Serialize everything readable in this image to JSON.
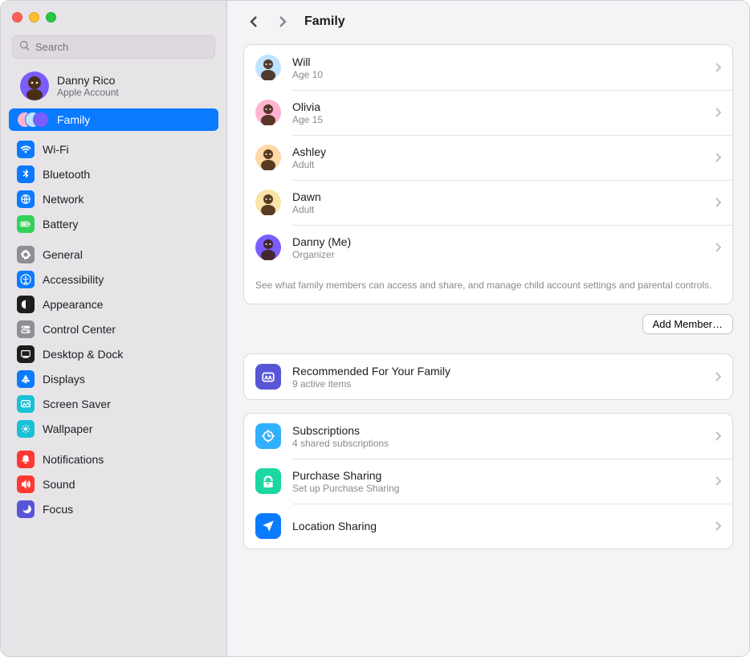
{
  "window": {
    "title": "Family"
  },
  "search": {
    "placeholder": "Search"
  },
  "account": {
    "name": "Danny Rico",
    "subtitle": "Apple Account",
    "avatar_bg": "#7a5cff"
  },
  "sidebar": {
    "family_label": "Family",
    "groups": [
      {
        "items": [
          {
            "id": "wifi",
            "label": "Wi-Fi",
            "icon": "wifi",
            "bg": "#0a7aff"
          },
          {
            "id": "bluetooth",
            "label": "Bluetooth",
            "icon": "bluetooth",
            "bg": "#0a7aff"
          },
          {
            "id": "network",
            "label": "Network",
            "icon": "network",
            "bg": "#0a7aff"
          },
          {
            "id": "battery",
            "label": "Battery",
            "icon": "battery",
            "bg": "#32d158"
          }
        ]
      },
      {
        "items": [
          {
            "id": "general",
            "label": "General",
            "icon": "gear",
            "bg": "#8e8e93"
          },
          {
            "id": "accessibility",
            "label": "Accessibility",
            "icon": "accessibility",
            "bg": "#0a7aff"
          },
          {
            "id": "appearance",
            "label": "Appearance",
            "icon": "appearance",
            "bg": "#1d1d1f"
          },
          {
            "id": "control-center",
            "label": "Control Center",
            "icon": "control-center",
            "bg": "#8e8e93"
          },
          {
            "id": "desktop-dock",
            "label": "Desktop & Dock",
            "icon": "desktop-dock",
            "bg": "#1d1d1f"
          },
          {
            "id": "displays",
            "label": "Displays",
            "icon": "displays",
            "bg": "#0a7aff"
          },
          {
            "id": "screen-saver",
            "label": "Screen Saver",
            "icon": "screen-saver",
            "bg": "#19c1d6"
          },
          {
            "id": "wallpaper",
            "label": "Wallpaper",
            "icon": "wallpaper",
            "bg": "#19c1d6"
          }
        ]
      },
      {
        "items": [
          {
            "id": "notifications",
            "label": "Notifications",
            "icon": "notifications",
            "bg": "#ff3830"
          },
          {
            "id": "sound",
            "label": "Sound",
            "icon": "sound",
            "bg": "#ff3830"
          },
          {
            "id": "focus",
            "label": "Focus",
            "icon": "focus",
            "bg": "#5856d6"
          }
        ]
      }
    ]
  },
  "members": [
    {
      "name": "Will",
      "detail": "Age 10",
      "avatar_bg": "#bfe3ff"
    },
    {
      "name": "Olivia",
      "detail": "Age 15",
      "avatar_bg": "#ffb3d0"
    },
    {
      "name": "Ashley",
      "detail": "Adult",
      "avatar_bg": "#ffd9a8"
    },
    {
      "name": "Dawn",
      "detail": "Adult",
      "avatar_bg": "#f7e4a8"
    },
    {
      "name": "Danny (Me)",
      "detail": "Organizer",
      "avatar_bg": "#7a5cff"
    }
  ],
  "members_footnote": "See what family members can access and share, and manage child account settings and parental controls.",
  "add_member_label": "Add Member…",
  "sections": [
    {
      "id": "recommended",
      "title": "Recommended For Your Family",
      "subtitle": "9 active items",
      "icon": "family-rec",
      "bg": "#5856d6"
    }
  ],
  "sharing": [
    {
      "id": "subscriptions",
      "title": "Subscriptions",
      "subtitle": "4 shared subscriptions",
      "icon": "subscriptions",
      "bg": "#30b0ff"
    },
    {
      "id": "purchase-sharing",
      "title": "Purchase Sharing",
      "subtitle": "Set up Purchase Sharing",
      "icon": "purchase",
      "bg": "#1bd7a0"
    },
    {
      "id": "location-sharing",
      "title": "Location Sharing",
      "subtitle": "",
      "icon": "location",
      "bg": "#0a7aff"
    }
  ]
}
